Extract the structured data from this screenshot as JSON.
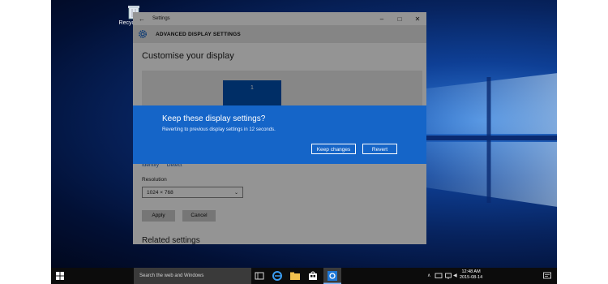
{
  "desktop": {
    "recycle_bin_label": "Recycle Bin"
  },
  "window": {
    "title": "Settings",
    "header_title": "ADVANCED DISPLAY SETTINGS",
    "heading": "Customise your display",
    "monitor_number": "1",
    "identify_link": "Identify",
    "detect_link": "Detect",
    "resolution_label": "Resolution",
    "resolution_value": "1024 × 768",
    "apply_label": "Apply",
    "cancel_label": "Cancel",
    "related_heading": "Related settings"
  },
  "dialog": {
    "title": "Keep these display settings?",
    "message": "Reverting to previous display settings in 12 seconds.",
    "keep_label": "Keep changes",
    "revert_label": "Revert",
    "accent_color": "#1565c8"
  },
  "taskbar": {
    "search_placeholder": "Search the web and Windows",
    "time": "12:48 AM",
    "date": "2015-08-14",
    "apps": [
      "task-view-icon",
      "edge-icon",
      "file-explorer-icon",
      "store-icon",
      "settings-icon"
    ]
  }
}
